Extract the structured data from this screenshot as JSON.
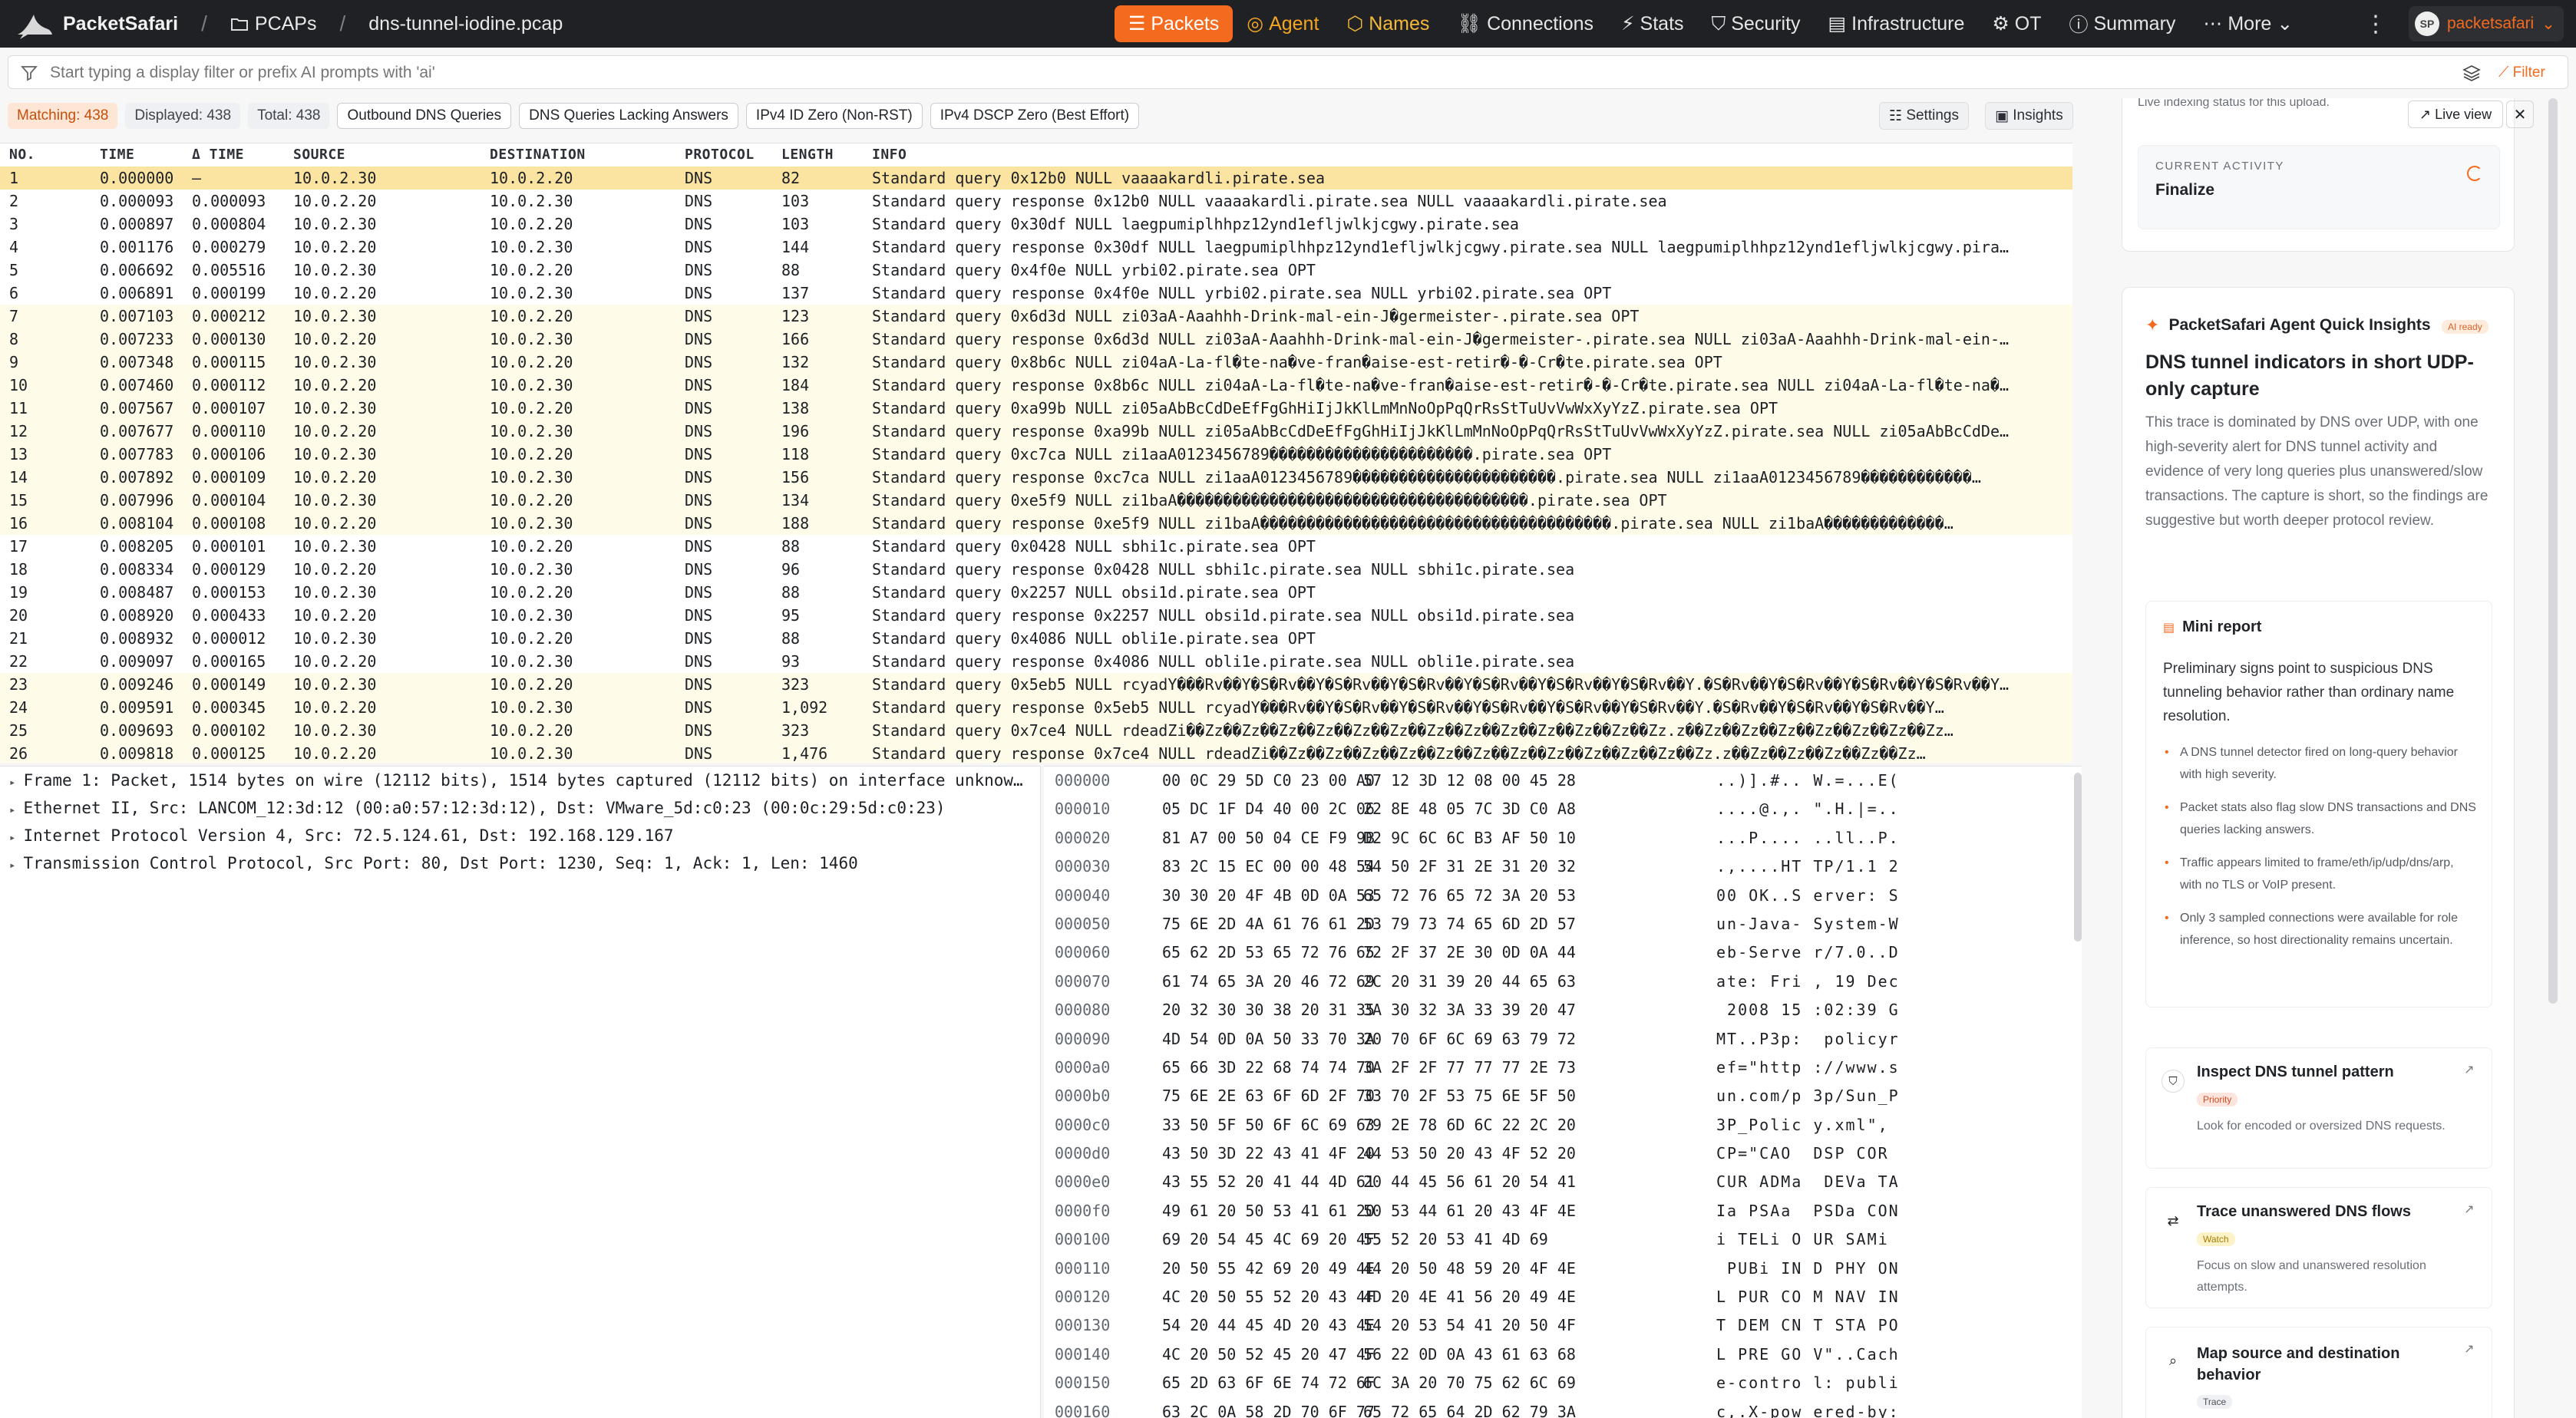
{
  "app": {
    "name": "PacketSafari",
    "crumb_pcaps": "PCAPs",
    "crumb_file": "dns-tunnel-iodine.pcap"
  },
  "nav": [
    {
      "label": "Packets",
      "icon": "list-icon",
      "active": true
    },
    {
      "label": "Agent",
      "icon": "agent-icon"
    },
    {
      "label": "Names",
      "icon": "names-icon"
    },
    {
      "label": "Connections",
      "icon": "connections-icon"
    },
    {
      "label": "Stats",
      "icon": "stats-icon"
    },
    {
      "label": "Security",
      "icon": "shield-icon"
    },
    {
      "label": "Infrastructure",
      "icon": "infrastructure-icon"
    },
    {
      "label": "OT",
      "icon": "ot-icon"
    },
    {
      "label": "Summary",
      "icon": "summary-icon"
    },
    {
      "label": "More",
      "icon": "more-icon"
    }
  ],
  "account": {
    "initials": "SP",
    "name": "packetsafari"
  },
  "filter": {
    "placeholder": "Start typing a display filter or prefix AI prompts with 'ai'",
    "button": "Filter"
  },
  "counts": {
    "matching": "Matching: 438",
    "displayed": "Displayed: 438",
    "total": "Total: 438"
  },
  "presets": [
    "Outbound DNS Queries",
    "DNS Queries Lacking Answers",
    "IPv4 ID Zero (Non-RST)",
    "IPv4 DSCP Zero (Best Effort)"
  ],
  "toolbar": {
    "settings": "Settings",
    "insights": "Insights"
  },
  "table": {
    "headers": [
      "NO.",
      "TIME",
      "Δ TIME",
      "SOURCE",
      "DESTINATION",
      "PROTOCOL",
      "LENGTH",
      "INFO"
    ],
    "rows": [
      [
        "1",
        "0.000000",
        "—",
        "10.0.2.30",
        "10.0.2.20",
        "DNS",
        "82",
        "Standard query 0x12b0 NULL vaaaakardli.pirate.sea"
      ],
      [
        "2",
        "0.000093",
        "0.000093",
        "10.0.2.20",
        "10.0.2.30",
        "DNS",
        "103",
        "Standard query response 0x12b0 NULL vaaaakardli.pirate.sea NULL vaaaakardli.pirate.sea"
      ],
      [
        "3",
        "0.000897",
        "0.000804",
        "10.0.2.30",
        "10.0.2.20",
        "DNS",
        "103",
        "Standard query 0x30df NULL laegpumiplhhpz12ynd1efljwlkjcgwy.pirate.sea"
      ],
      [
        "4",
        "0.001176",
        "0.000279",
        "10.0.2.20",
        "10.0.2.30",
        "DNS",
        "144",
        "Standard query response 0x30df NULL laegpumiplhhpz12ynd1efljwlkjcgwy.pirate.sea NULL laegpumiplhhpz12ynd1efljwlkjcgwy.pira…"
      ],
      [
        "5",
        "0.006692",
        "0.005516",
        "10.0.2.30",
        "10.0.2.20",
        "DNS",
        "88",
        "Standard query 0x4f0e NULL yrbi02.pirate.sea OPT"
      ],
      [
        "6",
        "0.006891",
        "0.000199",
        "10.0.2.20",
        "10.0.2.30",
        "DNS",
        "137",
        "Standard query response 0x4f0e NULL yrbi02.pirate.sea NULL yrbi02.pirate.sea OPT"
      ],
      [
        "7",
        "0.007103",
        "0.000212",
        "10.0.2.30",
        "10.0.2.20",
        "DNS",
        "123",
        "Standard query 0x6d3d NULL zi03aA-Aaahhh-Drink-mal-ein-J�germeister-.pirate.sea OPT"
      ],
      [
        "8",
        "0.007233",
        "0.000130",
        "10.0.2.20",
        "10.0.2.30",
        "DNS",
        "166",
        "Standard query response 0x6d3d NULL zi03aA-Aaahhh-Drink-mal-ein-J�germeister-.pirate.sea NULL zi03aA-Aaahhh-Drink-mal-ein-…"
      ],
      [
        "9",
        "0.007348",
        "0.000115",
        "10.0.2.30",
        "10.0.2.20",
        "DNS",
        "132",
        "Standard query 0x8b6c NULL zi04aA-La-fl�te-na�ve-fran�aise-est-retir�-�-Cr�te.pirate.sea OPT"
      ],
      [
        "10",
        "0.007460",
        "0.000112",
        "10.0.2.20",
        "10.0.2.30",
        "DNS",
        "184",
        "Standard query response 0x8b6c NULL zi04aA-La-fl�te-na�ve-fran�aise-est-retir�-�-Cr�te.pirate.sea NULL zi04aA-La-fl�te-na�…"
      ],
      [
        "11",
        "0.007567",
        "0.000107",
        "10.0.2.30",
        "10.0.2.20",
        "DNS",
        "138",
        "Standard query 0xa99b NULL zi05aAbBcCdDeEfFgGhHiIjJkKlLmMnNoOpPqQrRsStTuUvVwWxXyYzZ.pirate.sea OPT"
      ],
      [
        "12",
        "0.007677",
        "0.000110",
        "10.0.2.20",
        "10.0.2.30",
        "DNS",
        "196",
        "Standard query response 0xa99b NULL zi05aAbBcCdDeEfFgGhHiIjJkKlLmMnNoOpPqQrRsStTuUvVwWxXyYzZ.pirate.sea NULL zi05aAbBcCdDe…"
      ],
      [
        "13",
        "0.007783",
        "0.000106",
        "10.0.2.30",
        "10.0.2.20",
        "DNS",
        "118",
        "Standard query 0xc7ca NULL zi1aaA0123456789����������������������.pirate.sea OPT"
      ],
      [
        "14",
        "0.007892",
        "0.000109",
        "10.0.2.20",
        "10.0.2.30",
        "DNS",
        "156",
        "Standard query response 0xc7ca NULL zi1aaA0123456789����������������������.pirate.sea NULL zi1aaA0123456789������������…"
      ],
      [
        "15",
        "0.007996",
        "0.000104",
        "10.0.2.30",
        "10.0.2.20",
        "DNS",
        "134",
        "Standard query 0xe5f9 NULL zi1baA��������������������������������������.pirate.sea OPT"
      ],
      [
        "16",
        "0.008104",
        "0.000108",
        "10.0.2.20",
        "10.0.2.30",
        "DNS",
        "188",
        "Standard query response 0xe5f9 NULL zi1baA��������������������������������������.pirate.sea NULL zi1baA�������������…"
      ],
      [
        "17",
        "0.008205",
        "0.000101",
        "10.0.2.30",
        "10.0.2.20",
        "DNS",
        "88",
        "Standard query 0x0428 NULL sbhi1c.pirate.sea OPT"
      ],
      [
        "18",
        "0.008334",
        "0.000129",
        "10.0.2.20",
        "10.0.2.30",
        "DNS",
        "96",
        "Standard query response 0x0428 NULL sbhi1c.pirate.sea NULL sbhi1c.pirate.sea"
      ],
      [
        "19",
        "0.008487",
        "0.000153",
        "10.0.2.30",
        "10.0.2.20",
        "DNS",
        "88",
        "Standard query 0x2257 NULL obsi1d.pirate.sea OPT"
      ],
      [
        "20",
        "0.008920",
        "0.000433",
        "10.0.2.20",
        "10.0.2.30",
        "DNS",
        "95",
        "Standard query response 0x2257 NULL obsi1d.pirate.sea NULL obsi1d.pirate.sea"
      ],
      [
        "21",
        "0.008932",
        "0.000012",
        "10.0.2.30",
        "10.0.2.20",
        "DNS",
        "88",
        "Standard query 0x4086 NULL obli1e.pirate.sea OPT"
      ],
      [
        "22",
        "0.009097",
        "0.000165",
        "10.0.2.20",
        "10.0.2.30",
        "DNS",
        "93",
        "Standard query response 0x4086 NULL obli1e.pirate.sea NULL obli1e.pirate.sea"
      ],
      [
        "23",
        "0.009246",
        "0.000149",
        "10.0.2.30",
        "10.0.2.20",
        "DNS",
        "323",
        "Standard query 0x5eb5 NULL rcyadY���Rv��Y�S�Rv��Y�S�Rv��Y�S�Rv��Y�S�Rv��Y�S�Rv��Y�S�Rv��Y.�S�Rv��Y�S�Rv��Y�S�Rv��Y�S�Rv��Y…"
      ],
      [
        "24",
        "0.009591",
        "0.000345",
        "10.0.2.20",
        "10.0.2.30",
        "DNS",
        "1,092",
        "Standard query response 0x5eb5 NULL rcyadY���Rv��Y�S�Rv��Y�S�Rv��Y�S�Rv��Y�S�Rv��Y�S�Rv��Y.�S�Rv��Y�S�Rv��Y�S�Rv��Y…"
      ],
      [
        "25",
        "0.009693",
        "0.000102",
        "10.0.2.30",
        "10.0.2.20",
        "DNS",
        "323",
        "Standard query 0x7ce4 NULL rdeadZi��Zz��Zz��Zz��Zz��Zz��Zz��Zz��Zz��Zz��Zz��Zz��Zz��Zz.z��Zz��Zz��Zz��Zz��Zz��Zz��Zz…"
      ],
      [
        "26",
        "0.009818",
        "0.000125",
        "10.0.2.20",
        "10.0.2.30",
        "DNS",
        "1,476",
        "Standard query response 0x7ce4 NULL rdeadZi��Zz��Zz��Zz��Zz��Zz��Zz��Zz��Zz��Zz��Zz��Zz��Zz.z��Zz��Zz��Zz��Zz��Zz…"
      ]
    ]
  },
  "details": [
    "Frame 1: Packet, 1514 bytes on wire (12112 bits), 1514 bytes captured (12112 bits) on interface unknow…",
    "Ethernet II, Src: LANCOM_12:3d:12 (00:a0:57:12:3d:12), Dst: VMware_5d:c0:23 (00:0c:29:5d:c0:23)",
    "Internet Protocol Version 4, Src: 72.5.124.61, Dst: 192.168.129.167",
    "Transmission Control Protocol, Src Port: 80, Dst Port: 1230, Seq: 1, Ack: 1, Len: 1460"
  ],
  "hex": [
    [
      "000000",
      "00 0C 29 5D C0 23 00 A0",
      "57 12 3D 12 08 00 45 28",
      "..)].#.. W.=...E("
    ],
    [
      "000010",
      "05 DC 1F D4 40 00 2C 06",
      "22 8E 48 05 7C 3D C0 A8",
      "....@.,. \".H.|=.."
    ],
    [
      "000020",
      "81 A7 00 50 04 CE F9 9B",
      "D2 9C 6C 6C B3 AF 50 10",
      "...P.... ..ll..P."
    ],
    [
      "000030",
      "83 2C 15 EC 00 00 48 54",
      "54 50 2F 31 2E 31 20 32",
      ".,....HT TP/1.1 2"
    ],
    [
      "000040",
      "30 30 20 4F 4B 0D 0A 53",
      "65 72 76 65 72 3A 20 53",
      "00 OK..S erver: S"
    ],
    [
      "000050",
      "75 6E 2D 4A 61 76 61 2D",
      "53 79 73 74 65 6D 2D 57",
      "un-Java- System-W"
    ],
    [
      "000060",
      "65 62 2D 53 65 72 76 65",
      "72 2F 37 2E 30 0D 0A 44",
      "eb-Serve r/7.0..D"
    ],
    [
      "000070",
      "61 74 65 3A 20 46 72 69",
      "2C 20 31 39 20 44 65 63",
      "ate: Fri , 19 Dec"
    ],
    [
      "000080",
      "20 32 30 30 38 20 31 35",
      "3A 30 32 3A 33 39 20 47",
      " 2008 15 :02:39 G"
    ],
    [
      "000090",
      "4D 54 0D 0A 50 33 70 3A",
      "20 70 6F 6C 69 63 79 72",
      "MT..P3p:  policyr"
    ],
    [
      "0000a0",
      "65 66 3D 22 68 74 74 70",
      "3A 2F 2F 77 77 77 2E 73",
      "ef=\"http ://www.s"
    ],
    [
      "0000b0",
      "75 6E 2E 63 6F 6D 2F 70",
      "33 70 2F 53 75 6E 5F 50",
      "un.com/p 3p/Sun_P"
    ],
    [
      "0000c0",
      "33 50 5F 50 6F 6C 69 63",
      "79 2E 78 6D 6C 22 2C 20",
      "3P_Polic y.xml\", "
    ],
    [
      "0000d0",
      "43 50 3D 22 43 41 4F 20",
      "44 53 50 20 43 4F 52 20",
      "CP=\"CAO  DSP COR "
    ],
    [
      "0000e0",
      "43 55 52 20 41 44 4D 61",
      "20 44 45 56 61 20 54 41",
      "CUR ADMa  DEVa TA"
    ],
    [
      "0000f0",
      "49 61 20 50 53 41 61 20",
      "50 53 44 61 20 43 4F 4E",
      "Ia PSAa  PSDa CON"
    ],
    [
      "000100",
      "69 20 54 45 4C 69 20 4F",
      "55 52 20 53 41 4D 69",
      "i TELi O UR SAMi"
    ],
    [
      "000110",
      "20 50 55 42 69 20 49 4E",
      "44 20 50 48 59 20 4F 4E",
      " PUBi IN D PHY ON"
    ],
    [
      "000120",
      "4C 20 50 55 52 20 43 4F",
      "4D 20 4E 41 56 20 49 4E",
      "L PUR CO M NAV IN"
    ],
    [
      "000130",
      "54 20 44 45 4D 20 43 4E",
      "54 20 53 54 41 20 50 4F",
      "T DEM CN T STA PO"
    ],
    [
      "000140",
      "4C 20 50 52 45 20 47 4F",
      "56 22 0D 0A 43 61 63 68",
      "L PRE GO V\"..Cach"
    ],
    [
      "000150",
      "65 2D 63 6F 6E 74 72 6F",
      "6C 3A 20 70 75 62 6C 69",
      "e-contro l: publi"
    ],
    [
      "000160",
      "63 2C 0A 58 2D 70 6F 77",
      "65 72 65 64 2D 62 79 3A",
      "c,.X-pow ered-by:"
    ]
  ],
  "sidebar": {
    "live_text": "Live indexing status for this upload.",
    "live_view": "Live view",
    "activity_label": "CURRENT ACTIVITY",
    "activity_value": "Finalize",
    "insights_title": "PacketSafari Agent Quick Insights",
    "ai_badge": "AI ready",
    "headline": "DNS tunnel indicators in short UDP-only capture",
    "summary": "This trace is dominated by DNS over UDP, with one high-severity alert for DNS tunnel activity and evidence of very long queries plus unanswered/slow transactions. The capture is short, so the findings are suggestive but worth deeper protocol review.",
    "mini_title": "Mini report",
    "mini_lead": "Preliminary signs point to suspicious DNS tunneling behavior rather than ordinary name resolution.",
    "bullets": [
      "A DNS tunnel detector fired on long-query behavior with high severity.",
      "Packet stats also flag slow DNS transactions and DNS queries lacking answers.",
      "Traffic appears limited to frame/eth/ip/udp/dns/arp, with no TLS or VoIP present.",
      "Only 3 sampled connections were available for role inference, so host directionality remains uncertain."
    ],
    "actions": [
      {
        "title": "Inspect DNS tunnel pattern",
        "tag": "Priority",
        "desc": "Look for encoded or oversized DNS requests.",
        "icon": "shield-icon"
      },
      {
        "title": "Trace unanswered DNS flows",
        "tag": "Watch",
        "desc": "Focus on slow and unanswered resolution attempts.",
        "icon": "flows-icon"
      },
      {
        "title": "Map source and destination behavior",
        "tag": "Trace",
        "desc": "",
        "icon": "search-icon"
      }
    ]
  },
  "colors": {
    "accent": "#f46a1f",
    "topbar": "#1f2124",
    "selected_row": "#fbe3a2",
    "alt_row": "#fefbe8"
  }
}
